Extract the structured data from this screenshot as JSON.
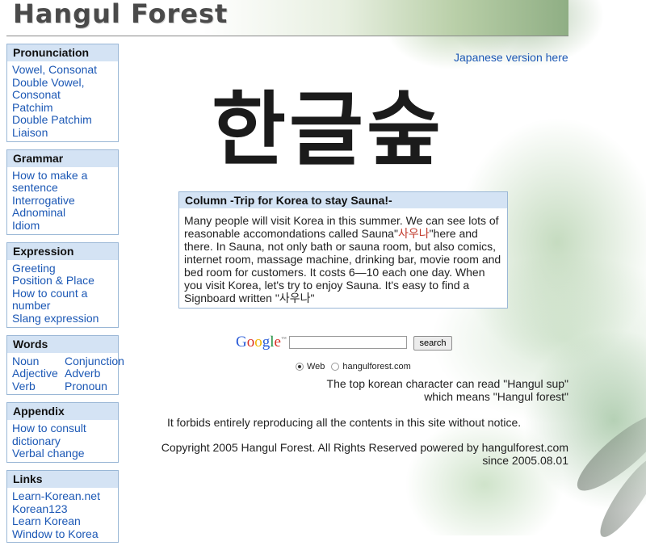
{
  "header": {
    "site_title": "Hangul Forest"
  },
  "sidebar": {
    "pronunciation": {
      "title": "Pronunciation",
      "items": [
        "Vowel, Consonat",
        "Double Vowel, Consonat",
        "Patchim",
        "Double Patchim",
        "Liaison"
      ]
    },
    "grammar": {
      "title": "Grammar",
      "items": [
        "How to make a sentence",
        "Interrogative",
        "Adnominal",
        "Idiom"
      ]
    },
    "expression": {
      "title": "Expression",
      "items": [
        "Greeting",
        "Position & Place",
        "How to count a number",
        "Slang expression"
      ]
    },
    "words": {
      "title": "Words",
      "items": [
        "Noun",
        "Conjunction",
        "Adjective",
        "Adverb",
        "Verb",
        "Pronoun"
      ]
    },
    "appendix": {
      "title": "Appendix",
      "items": [
        "How to consult dictionary",
        "Verbal change"
      ]
    },
    "links": {
      "title": "Links",
      "items": [
        "Learn-Korean.net",
        "Korean123",
        "Learn Korean",
        "Window to Korea"
      ]
    }
  },
  "main": {
    "japanese_link": "Japanese version here",
    "logo_text": "한글숲",
    "column": {
      "title": "Column -Trip for Korea to stay Sauna!-",
      "body_part1": "Many people will visit Korea in this summer. We can see lots of reasonable accomondations called Sauna\"",
      "body_korean": "사우나",
      "body_part2": "\"here and there. In Sauna, not only bath or sauna room, but also comics, internet room, massage machine, drinking bar, movie room and bed room for customers. It costs 6—10 each one day. When you visit Korea, let's try to enjoy Sauna. It's easy to find a Signboard written \"사우나\""
    },
    "search": {
      "google_label": "Google",
      "google_tm": "™",
      "button": "search",
      "option_web": "Web",
      "option_site": "hangulforest.com"
    },
    "note_line1": "The top korean character can read \"Hangul sup\"",
    "note_line2": "which means \"Hangul forest\"",
    "forbid": "It forbids entirely reproducing all the contents in this site without notice.",
    "copyright_line1": "Copyright 2005 Hangul Forest. All Rights Reserved powered by hangulforest.com",
    "copyright_line2": "since 2005.08.01"
  },
  "colors": {
    "link": "#1c58b5",
    "box_header": "#d4e3f4",
    "box_border": "#9ab7d6",
    "korean_highlight": "#c0392b"
  }
}
